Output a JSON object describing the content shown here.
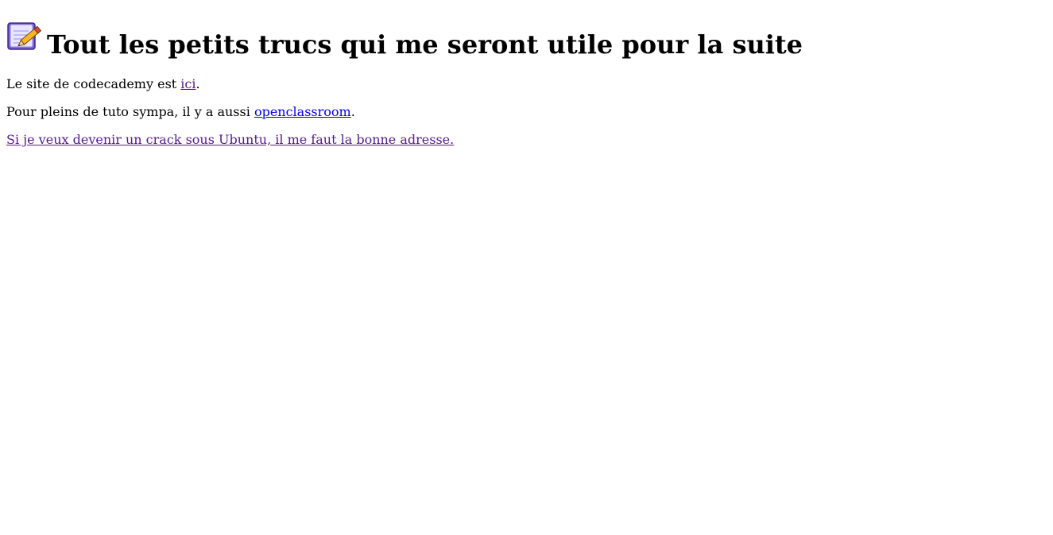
{
  "heading": {
    "icon": "notepad-pencil-icon",
    "text": "Tout les petits trucs qui me seront utile pour la suite"
  },
  "lines": [
    {
      "before": "Le site de codecademy est ",
      "link": "ici",
      "after": "."
    },
    {
      "before": "Pour pleins de tuto sympa, il y a aussi ",
      "link": "openclassroom",
      "after": "."
    },
    {
      "link": "Si je veux devenir un crack sous Ubuntu, il me faut la bonne adresse."
    }
  ],
  "colors": {
    "text": "#000000",
    "link_visited": "#551a8b",
    "link_unvisited": "#0000ee",
    "background": "#ffffff"
  }
}
